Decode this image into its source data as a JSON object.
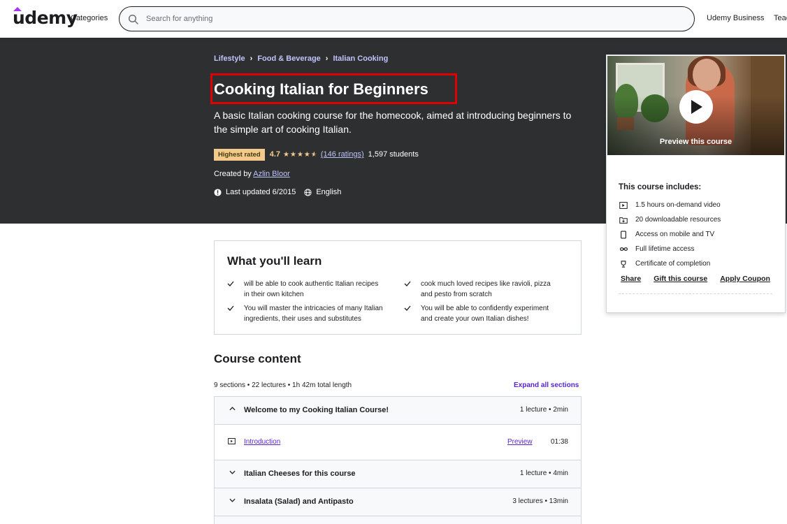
{
  "header": {
    "logo": "udemy",
    "categories": "Categories",
    "search_placeholder": "Search for anything",
    "udemy_business": "Udemy Business",
    "teach": "Teach on Udemy"
  },
  "breadcrumb": [
    "Lifestyle",
    "Food & Beverage",
    "Italian Cooking"
  ],
  "course": {
    "title": "Cooking Italian for Beginners",
    "subtitle": "A basic Italian cooking course for the homecook, aimed at introducing beginners to the simple art of cooking Italian.",
    "badge": "Highest rated",
    "rating": "4.7",
    "rating_stars": 4.5,
    "ratings_count": "(146 ratings)",
    "students": "1,597 students",
    "created_by_label": "Created by",
    "author": "Azlin Bloor",
    "last_updated": "Last updated 6/2015",
    "language": "English"
  },
  "sidebar": {
    "preview_label": "Preview this course",
    "includes_title": "This course includes:",
    "includes": [
      {
        "icon": "video-icon",
        "text": "1.5 hours on-demand video"
      },
      {
        "icon": "download-icon",
        "text": "20 downloadable resources"
      },
      {
        "icon": "mobile-icon",
        "text": "Access on mobile and TV"
      },
      {
        "icon": "infinity-icon",
        "text": "Full lifetime access"
      },
      {
        "icon": "trophy-icon",
        "text": "Certificate of completion"
      }
    ],
    "share": "Share",
    "gift": "Gift this course",
    "coupon": "Apply Coupon"
  },
  "learn": {
    "title": "What you'll learn",
    "items": [
      "will be able to cook authentic Italian recipes in their own kitchen",
      "cook much loved recipes like ravioli, pizza and pesto from scratch",
      "You will master the intricacies of many Italian ingredients, their uses and substitutes",
      "You will be able to confidently experiment and create your own Italian dishes!"
    ]
  },
  "content": {
    "title": "Course content",
    "stats": "9 sections • 22 lectures • 1h 42m total length",
    "expand_all": "Expand all sections",
    "sections": [
      {
        "title": "Welcome to my Cooking Italian Course!",
        "meta": "1 lecture • 2min",
        "expanded": true,
        "lectures": [
          {
            "title": "Introduction",
            "preview": "Preview",
            "duration": "01:38"
          }
        ]
      },
      {
        "title": "Italian Cheeses for this course",
        "meta": "1 lecture • 4min",
        "expanded": false
      },
      {
        "title": "Insalata (Salad) and Antipasto",
        "meta": "3 lectures • 13min",
        "expanded": false
      }
    ]
  },
  "colors": {
    "hero_bg": "#2d2f31",
    "link_light": "#c0c4fc",
    "accent_purple": "#5624d0",
    "badge_bg": "#f3ca8c",
    "star": "#f3ca8c",
    "highlight_box": "#e00000"
  }
}
